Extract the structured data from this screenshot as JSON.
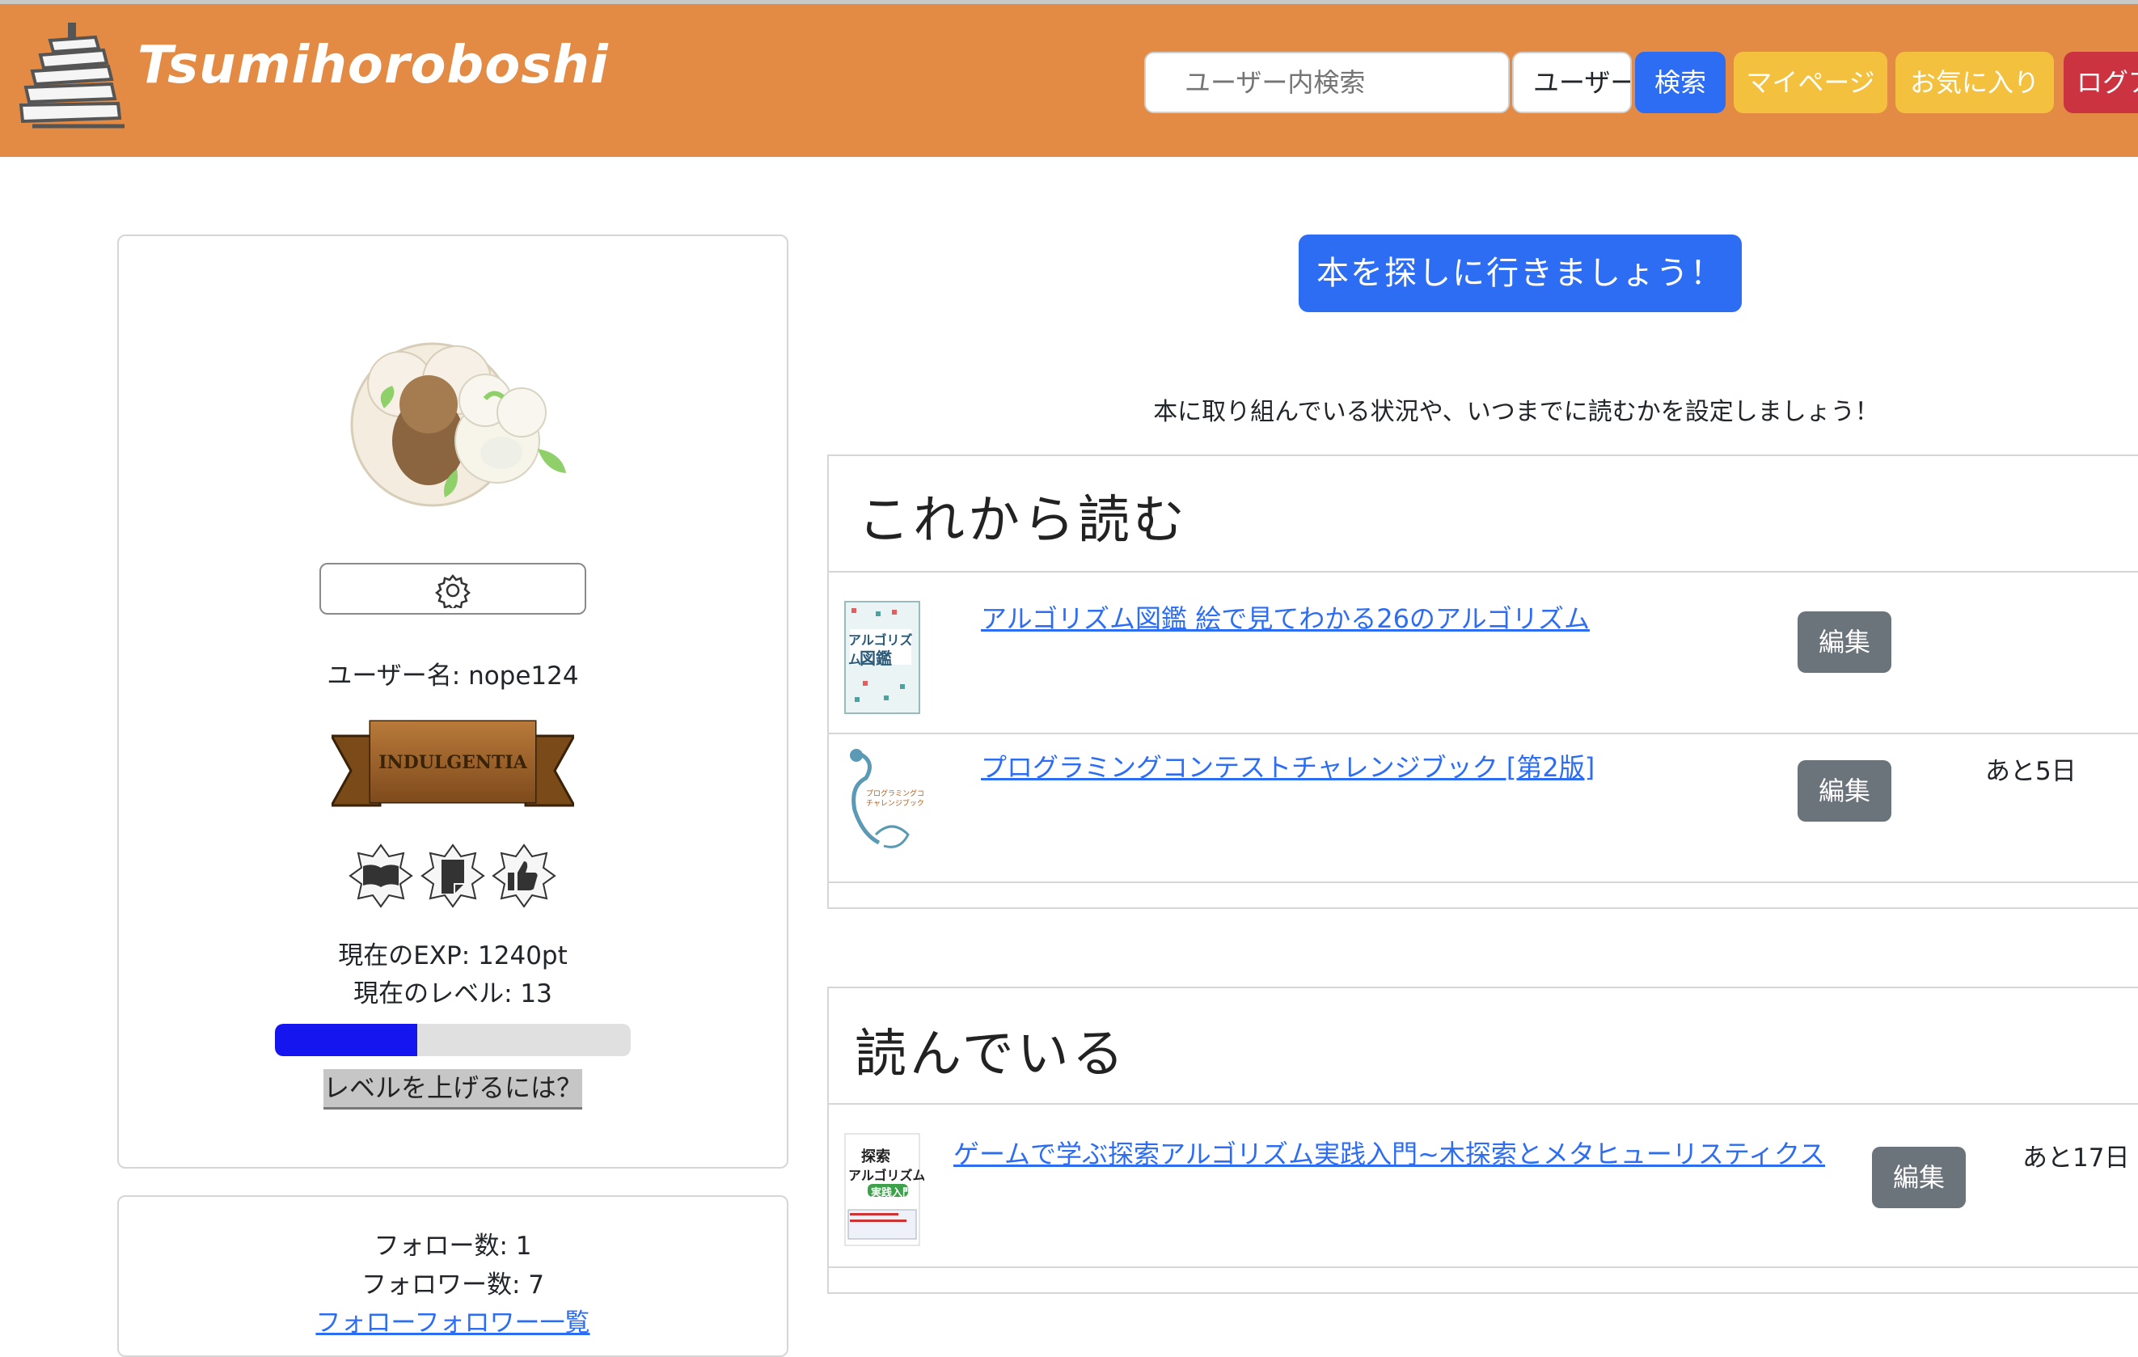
{
  "header": {
    "brand": "Tsumihoroboshi",
    "search_placeholder": "ユーザー内検索",
    "search_scope": "ユーザー",
    "search_button": "検索",
    "mypage_button": "マイページ",
    "favorites_button": "お気に入り",
    "logout_button": "ログアウト",
    "colors": {
      "bar": "#e38b45",
      "primary": "#2d6df4",
      "warning": "#f4c13e",
      "danger": "#cc3340"
    }
  },
  "profile": {
    "username_line": "ユーザー名: nope124",
    "title_badge": "INDULGENTIA",
    "exp_line": "現在のEXP: 1240pt",
    "level_line": "現在のレベル: 13",
    "level_progress_percent": 40,
    "levelup_link": "レベルを上げるには？",
    "badges": [
      "book-open-icon",
      "book-note-icon",
      "thumbs-up-icon"
    ]
  },
  "follow": {
    "follow_count": "フォロー数: 1",
    "follower_count": "フォロワー数: 7",
    "list_link": "フォローフォロワー一覧"
  },
  "main": {
    "find_button": "本を探しに行きましょう！",
    "instruction": "本に取り組んでいる状況や、いつまでに読むかを設定しましょう！",
    "sections": [
      {
        "title": "これから読む",
        "books": [
          {
            "title": "アルゴリズム図鑑 絵で見てわかる26のアルゴリズム",
            "edit": "編集",
            "remaining": "",
            "cover_text": [
              "アルゴリズム",
              "図鑑"
            ]
          },
          {
            "title": "プログラミングコンテストチャレンジブック [第2版]",
            "edit": "編集",
            "remaining": "あと5日",
            "cover_text": [
              "プログラミングコンテスト",
              "チャレンジブック"
            ]
          }
        ]
      },
      {
        "title": "読んでいる",
        "books": [
          {
            "title": "ゲームで学ぶ探索アルゴリズム実践入門~木探索とメタヒューリスティクス",
            "edit": "編集",
            "remaining": "あと17日",
            "cover_text": [
              "探索",
              "アルゴリズム",
              "実践入門"
            ]
          }
        ]
      }
    ]
  }
}
